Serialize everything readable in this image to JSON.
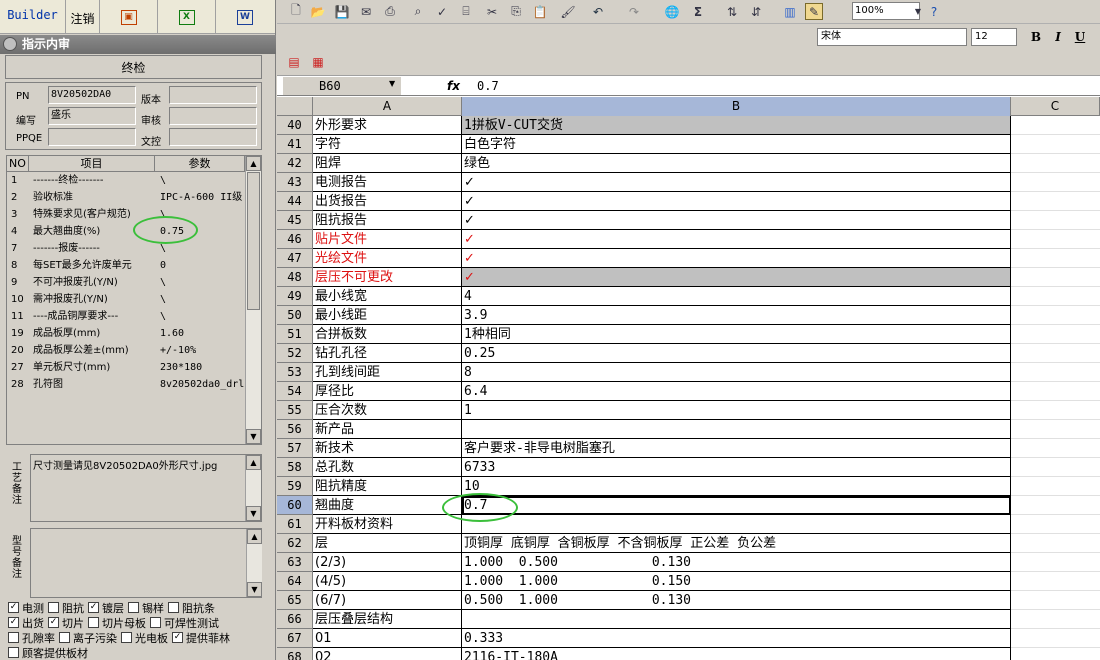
{
  "left_panel": {
    "tabs": {
      "builder": "Builder",
      "cancel": "注销"
    },
    "title": "指示内审",
    "stage": "终检",
    "fields": {
      "pn_label": "PN",
      "pn_value": "8V20502DA0",
      "version_label": "版本",
      "version_value": "",
      "author_label": "编写",
      "author_value": "盛乐",
      "review_label": "审核",
      "review_value": "",
      "ppqe_label": "PPQE",
      "ppqe_value": "",
      "doc_label": "文控",
      "doc_value": ""
    },
    "grid": {
      "headers": {
        "no": "NO",
        "item": "项目",
        "param": "参数"
      },
      "rows": [
        {
          "no": "1",
          "item": "-------终检-------",
          "param": "\\"
        },
        {
          "no": "2",
          "item": "验收标准",
          "param": "IPC-A-600 II级"
        },
        {
          "no": "3",
          "item": "特殊要求见(客户规范)",
          "param": "\\"
        },
        {
          "no": "4",
          "item": "最大翘曲度(%)",
          "param": "0.75"
        },
        {
          "no": "7",
          "item": "-------报废------",
          "param": "\\"
        },
        {
          "no": "8",
          "item": "每SET最多允许废单元",
          "param": "0"
        },
        {
          "no": "9",
          "item": "不可冲报废孔(Y/N)",
          "param": "\\"
        },
        {
          "no": "10",
          "item": "需冲报废孔(Y/N)",
          "param": "\\"
        },
        {
          "no": "11",
          "item": "----成品铜厚要求---",
          "param": "\\"
        },
        {
          "no": "19",
          "item": "成品板厚(mm)",
          "param": "1.60"
        },
        {
          "no": "20",
          "item": "成品板厚公差±(mm)",
          "param": "+/-10%"
        },
        {
          "no": "27",
          "item": "单元板尺寸(mm)",
          "param": "230*180"
        },
        {
          "no": "28",
          "item": "孔符图",
          "param": "8v20502da0_drl"
        }
      ]
    },
    "note1_label": "工艺备注",
    "note1_text": "尺寸测量请见8V20502DA0外形尺寸.jpg",
    "note2_label": "型号备注",
    "note2_text": "",
    "checks": [
      [
        {
          "label": "电测",
          "checked": true
        },
        {
          "label": "阻抗",
          "checked": false
        },
        {
          "label": "镀层",
          "checked": true
        },
        {
          "label": "锡样",
          "checked": false
        },
        {
          "label": "阻抗条",
          "checked": false
        }
      ],
      [
        {
          "label": "出货",
          "checked": true
        },
        {
          "label": "切片",
          "checked": true
        },
        {
          "label": "切片母板",
          "checked": false
        },
        {
          "label": "可焊性测试",
          "checked": false
        }
      ],
      [
        {
          "label": "孔隙率",
          "checked": false
        },
        {
          "label": "离子污染",
          "checked": false
        },
        {
          "label": "光电板",
          "checked": false
        },
        {
          "label": "提供菲林",
          "checked": true
        }
      ],
      [
        {
          "label": "顾客提供板材",
          "checked": false
        }
      ]
    ]
  },
  "toolbar": {
    "zoom": "100%",
    "font_name": "宋体",
    "font_size": "12",
    "bold": "B",
    "italic": "I",
    "underline": "U"
  },
  "formula_bar": {
    "cell_ref": "B60",
    "fx": "fx",
    "value": "0.7"
  },
  "sheet": {
    "columns": {
      "a": "A",
      "b": "B",
      "c": "C"
    },
    "rows": [
      {
        "n": "40",
        "a": "外形要求",
        "b": "1拼板V-CUT交货"
      },
      {
        "n": "41",
        "a": "字符",
        "b": "白色字符"
      },
      {
        "n": "42",
        "a": "阻焊",
        "b": "绿色"
      },
      {
        "n": "43",
        "a": "电测报告",
        "b": "✓"
      },
      {
        "n": "44",
        "a": "出货报告",
        "b": "✓"
      },
      {
        "n": "45",
        "a": "阻抗报告",
        "b": "✓"
      },
      {
        "n": "46",
        "a": "贴片文件",
        "b": "✓"
      },
      {
        "n": "47",
        "a": "光绘文件",
        "b": "✓"
      },
      {
        "n": "48",
        "a": "层压不可更改",
        "b": "✓"
      },
      {
        "n": "49",
        "a": "最小线宽",
        "b": "4"
      },
      {
        "n": "50",
        "a": "最小线距",
        "b": "3.9"
      },
      {
        "n": "51",
        "a": "合拼板数",
        "b": "1种相同"
      },
      {
        "n": "52",
        "a": "钻孔孔径",
        "b": "0.25"
      },
      {
        "n": "53",
        "a": "孔到线间距",
        "b": "8"
      },
      {
        "n": "54",
        "a": "厚径比",
        "b": "6.4"
      },
      {
        "n": "55",
        "a": "压合次数",
        "b": "1"
      },
      {
        "n": "56",
        "a": "新产品",
        "b": ""
      },
      {
        "n": "57",
        "a": "新技术",
        "b": "客户要求-非导电树脂塞孔"
      },
      {
        "n": "58",
        "a": "总孔数",
        "b": "6733"
      },
      {
        "n": "59",
        "a": "阻抗精度",
        "b": "10"
      },
      {
        "n": "60",
        "a": "翘曲度",
        "b": "0.7"
      },
      {
        "n": "61",
        "a": "开料板材资料",
        "b": ""
      },
      {
        "n": "62",
        "a": "层",
        "b": "顶铜厚 底铜厚 含铜板厚 不含铜板厚 正公差 负公差"
      },
      {
        "n": "63",
        "a": "(2/3)",
        "b": "1.000  0.500            0.130"
      },
      {
        "n": "64",
        "a": "(4/5)",
        "b": "1.000  1.000            0.150"
      },
      {
        "n": "65",
        "a": "(6/7)",
        "b": "0.500  1.000            0.130"
      },
      {
        "n": "66",
        "a": "层压叠层结构",
        "b": ""
      },
      {
        "n": "67",
        "a": "01",
        "b": "0.333"
      },
      {
        "n": "68",
        "a": "02",
        "b": "2116-IT-180A"
      }
    ]
  }
}
